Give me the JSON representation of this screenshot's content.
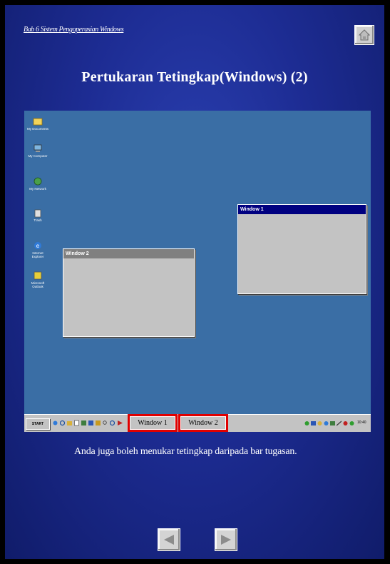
{
  "header": {
    "chapter_link": "Bab 6 Sistem Pengoperasian Windows",
    "home_icon": "home-icon"
  },
  "slide": {
    "title": "Pertukaran Tetingkap(Windows) (2)",
    "caption": "Anda juga boleh menukar tetingkap daripada bar tugasan."
  },
  "desktop": {
    "background_color": "#3a6ea5",
    "icons": [
      {
        "label": "My Documents",
        "icon": "folder-icon"
      },
      {
        "label": "My Computer",
        "icon": "computer-icon"
      },
      {
        "label": "My Network",
        "icon": "network-icon"
      },
      {
        "label": "Trash",
        "icon": "trash-icon"
      },
      {
        "label": "Internet Explorer",
        "icon": "ie-icon"
      },
      {
        "label": "Microsoft Outlook",
        "icon": "outlook-icon"
      }
    ],
    "windows": [
      {
        "title": "Window 1",
        "state": "active"
      },
      {
        "title": "Window 2",
        "state": "inactive"
      }
    ]
  },
  "taskbar": {
    "start_label": "START",
    "buttons": [
      {
        "label": "Window 1"
      },
      {
        "label": "Window 2"
      }
    ],
    "highlight_color": "#e00000",
    "clock": "10:40"
  },
  "navigation": {
    "prev_icon": "arrow-left-icon",
    "next_icon": "arrow-right-icon"
  }
}
